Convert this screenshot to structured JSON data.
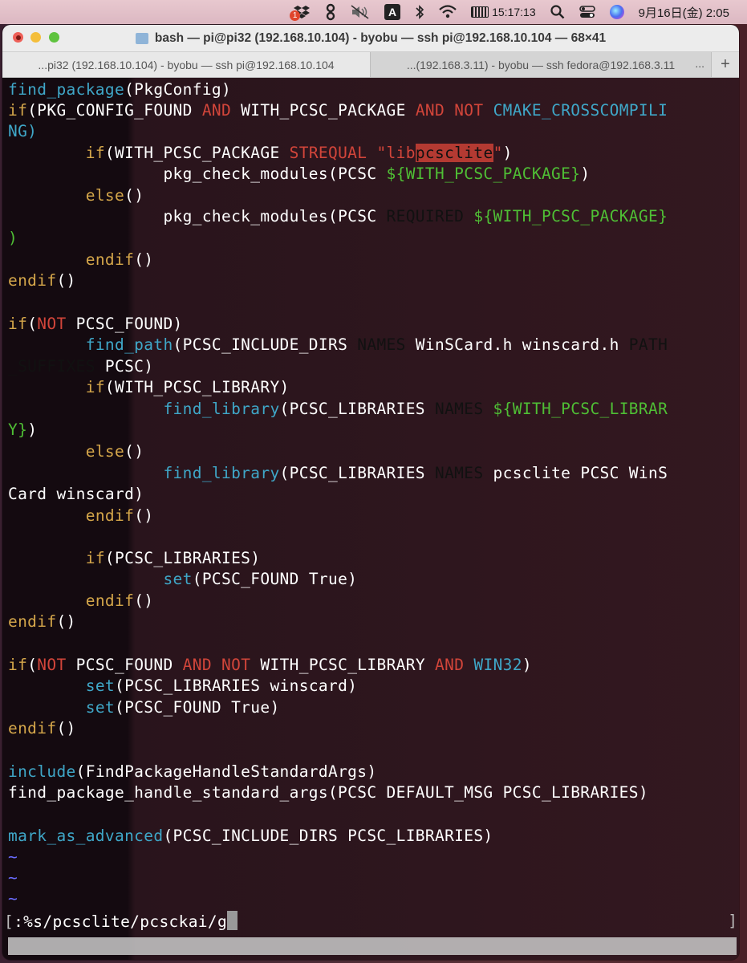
{
  "menubar": {
    "notification_badge": "1",
    "input_mode": "A",
    "clock": "15:17:13",
    "datetime": "9月16日(金)  2:05"
  },
  "window": {
    "title": "bash — pi@pi32 (192.168.10.104) - byobu — ssh pi@192.168.10.104 — 68×41",
    "tabs": [
      {
        "label": "...pi32 (192.168.10.104) - byobu — ssh pi@192.168.10.104",
        "active": true
      },
      {
        "label": "...(192.168.3.11) - byobu — ssh fedora@192.168.3.11",
        "active": false
      }
    ],
    "tab_overflow": "...",
    "new_tab": "+"
  },
  "code": {
    "l1": [
      "find_package",
      "(PkgConfig)"
    ],
    "l2": [
      "if",
      "(PKG_CONFIG_FOUND ",
      "AND",
      " WITH_PCSC_PACKAGE ",
      "AND",
      " ",
      "NOT",
      " ",
      "CMAKE_CROSSCOMPILI"
    ],
    "l3": [
      "NG)"
    ],
    "l4": [
      "        ",
      "if",
      "(WITH_PCSC_PACKAGE ",
      "STREQUAL",
      " ",
      "\"lib",
      "pcsclite",
      "\"",
      ")"
    ],
    "l5": [
      "                ",
      "pkg_check_modules(PCSC ",
      "${WITH_PCSC_PACKAGE}",
      ")"
    ],
    "l6": [
      "        ",
      "else",
      "()"
    ],
    "l7": [
      "                ",
      "pkg_check_modules(PCSC ",
      "REQUIRED",
      " ",
      "${WITH_PCSC_PACKAGE}"
    ],
    "l8": [
      ")"
    ],
    "l9": [
      "        ",
      "endif",
      "()"
    ],
    "l10": [
      "endif",
      "()"
    ],
    "l12": [
      "if",
      "(",
      "NOT",
      " PCSC_FOUND)"
    ],
    "l13": [
      "        ",
      "find_path",
      "(PCSC_INCLUDE_DIRS ",
      "NAMES",
      " WinSCard.h winscard.h ",
      "PATH"
    ],
    "l14": [
      "_SUFFIXES",
      " PCSC)"
    ],
    "l15": [
      "        ",
      "if",
      "(WITH_PCSC_LIBRARY)"
    ],
    "l16": [
      "                ",
      "find_library",
      "(PCSC_LIBRARIES ",
      "NAMES",
      " ",
      "${WITH_PCSC_LIBRAR"
    ],
    "l17": [
      "Y}",
      ")"
    ],
    "l18": [
      "        ",
      "else",
      "()"
    ],
    "l19": [
      "                ",
      "find_library",
      "(PCSC_LIBRARIES ",
      "NAMES",
      " pcsclite PCSC WinS"
    ],
    "l20": [
      "Card winscard)"
    ],
    "l21": [
      "        ",
      "endif",
      "()"
    ],
    "l23": [
      "        ",
      "if",
      "(PCSC_LIBRARIES)"
    ],
    "l24": [
      "                ",
      "set",
      "(PCSC_FOUND True)"
    ],
    "l25": [
      "        ",
      "endif",
      "()"
    ],
    "l26": [
      "endif",
      "()"
    ],
    "l28": [
      "if",
      "(",
      "NOT",
      " PCSC_FOUND ",
      "AND",
      " ",
      "NOT",
      " WITH_PCSC_LIBRARY ",
      "AND",
      " ",
      "WIN32",
      ")"
    ],
    "l29": [
      "        ",
      "set",
      "(PCSC_LIBRARIES winscard)"
    ],
    "l30": [
      "        ",
      "set",
      "(PCSC_FOUND True)"
    ],
    "l31": [
      "endif",
      "()"
    ],
    "l33": [
      "include",
      "(FindPackageHandleStandardArgs)"
    ],
    "l34": [
      "find_package_handle_standard_args(PCSC DEFAULT_MSG PCSC_LIBRARIES)"
    ],
    "l36": [
      "mark_as_advanced",
      "(PCSC_INCLUDE_DIRS PCSC_LIBRARIES)"
    ],
    "tilde": "~",
    "command": ":%s/pcsclite/pcsckai/g"
  }
}
